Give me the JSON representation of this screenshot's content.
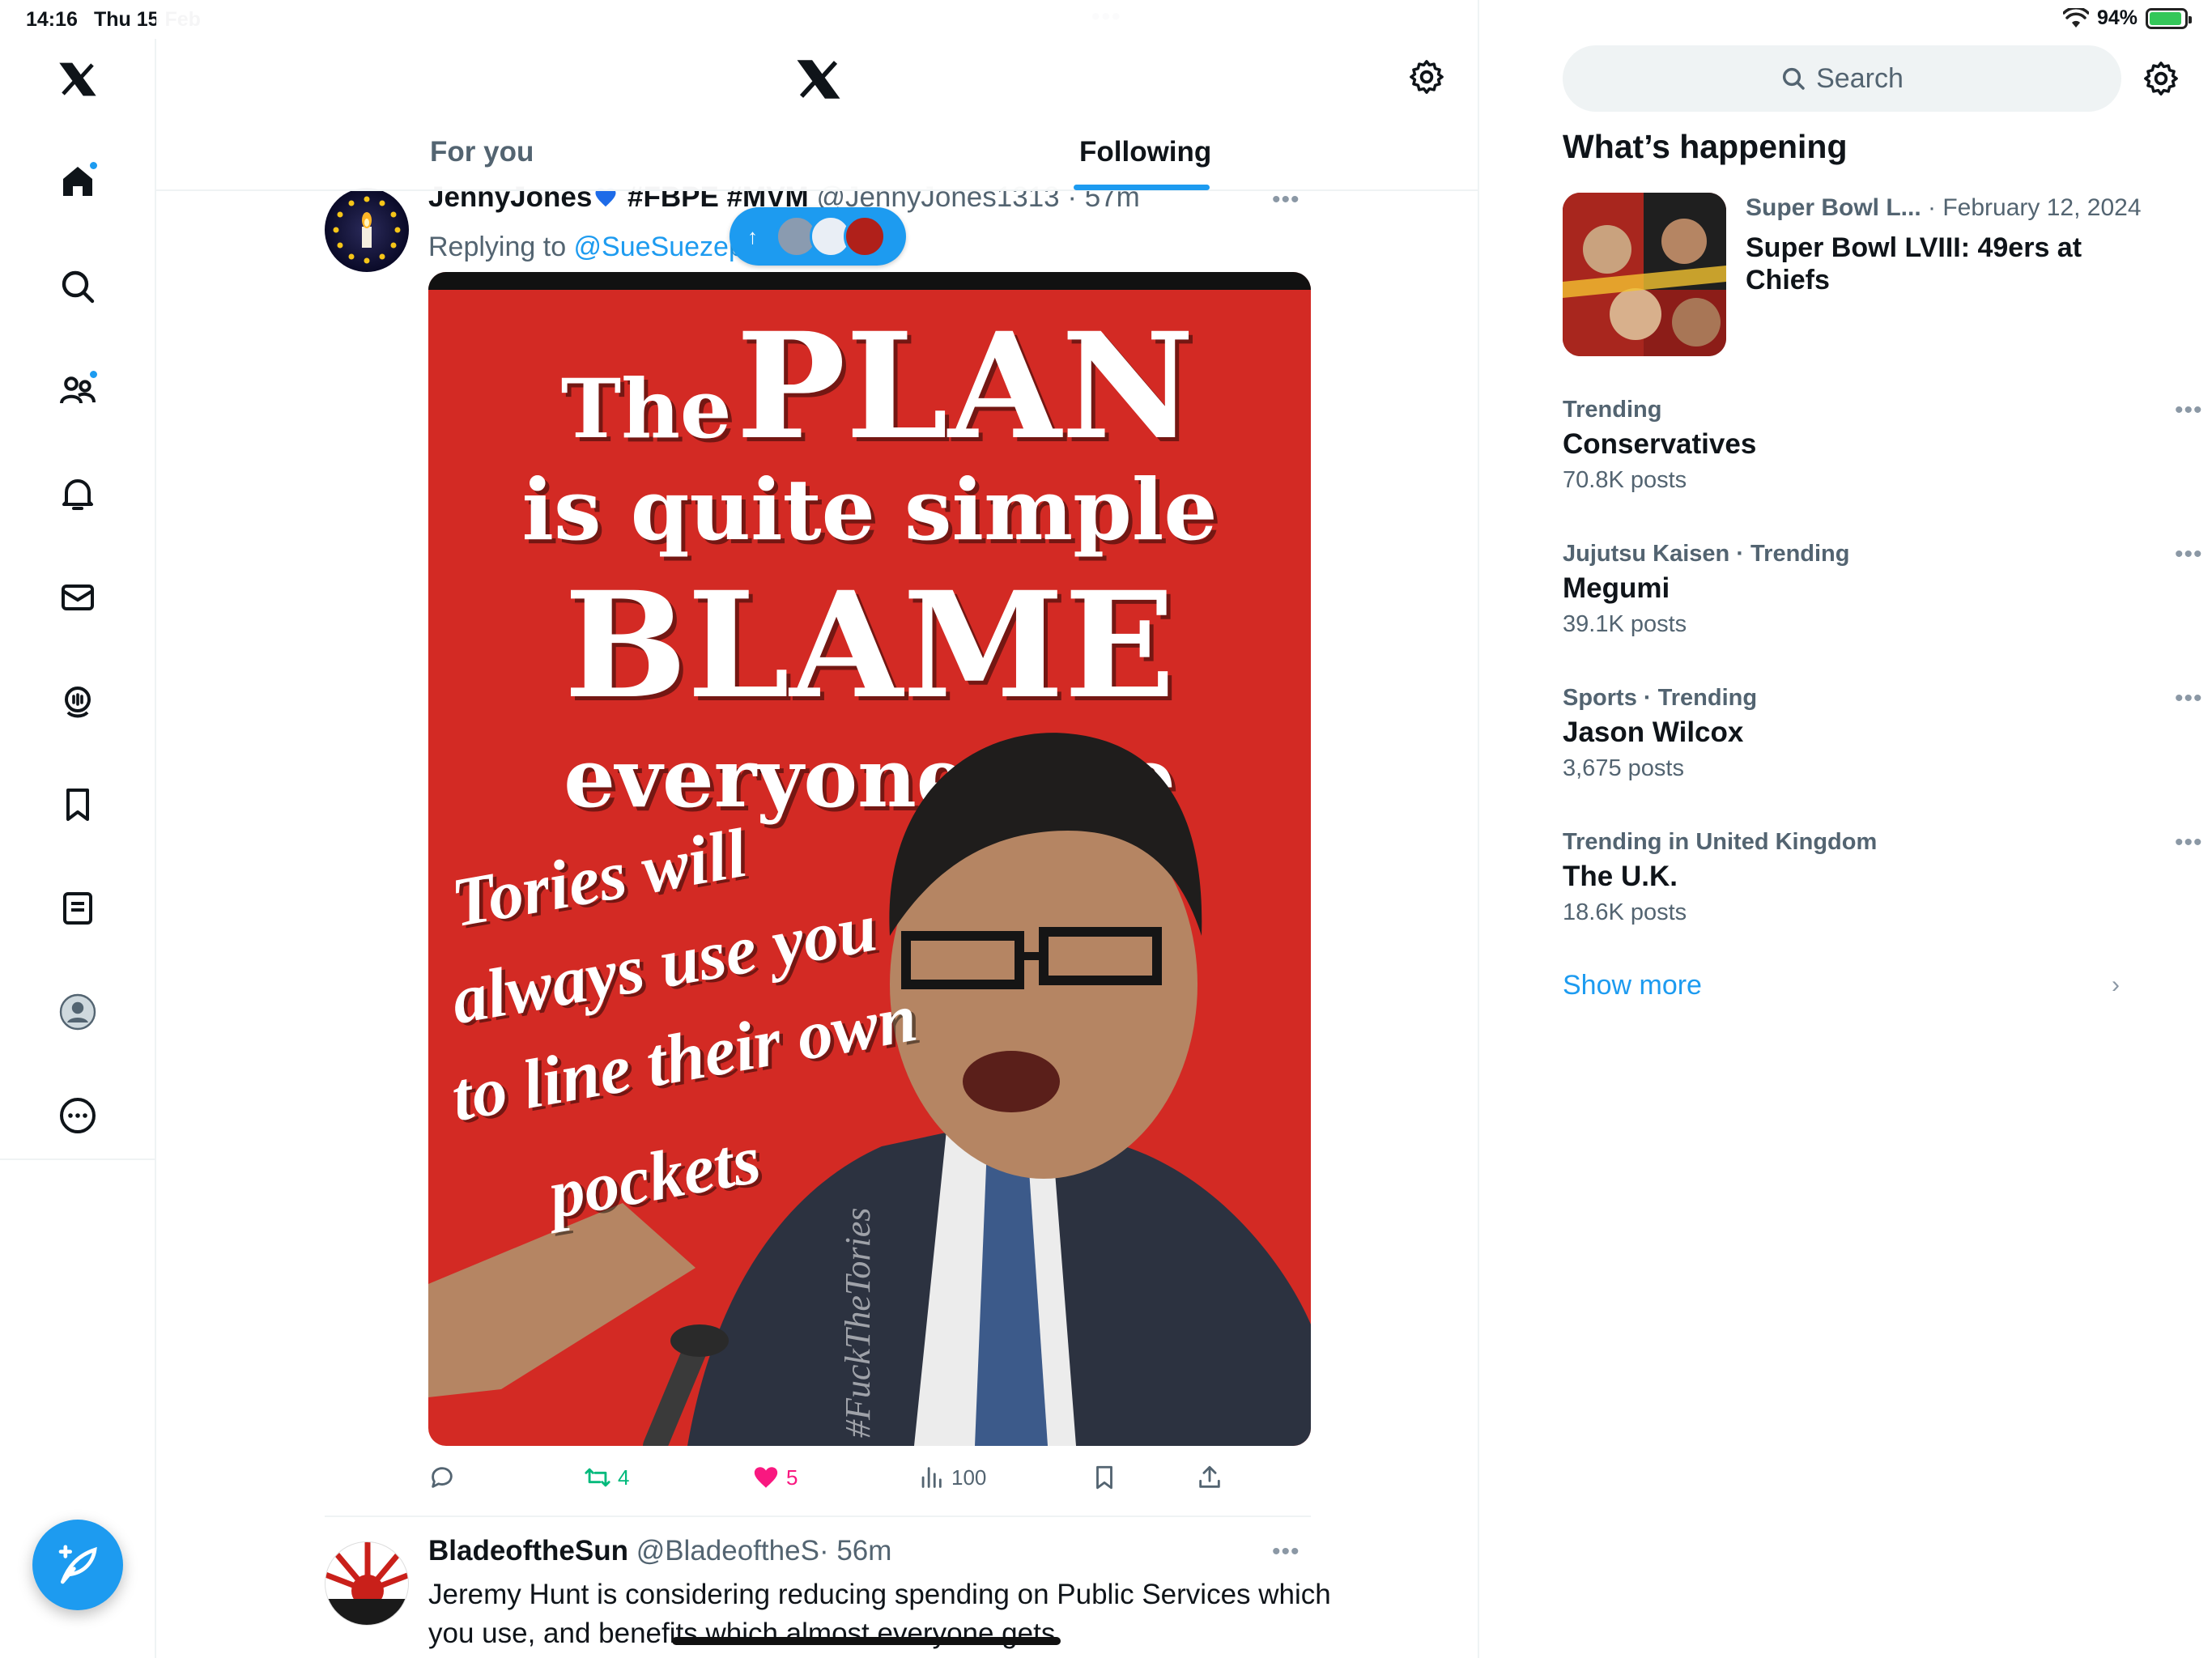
{
  "status_bar": {
    "time": "14:16",
    "date": "Thu 15 Feb",
    "battery": "94%",
    "battery_level": 0.94
  },
  "header": {
    "tabs": [
      {
        "label": "For you",
        "active": false
      },
      {
        "label": "Following",
        "active": true
      }
    ]
  },
  "tweets": [
    {
      "name": "JennyJones",
      "tags": "#FBPE #MVM",
      "handle": "@JennyJones1313",
      "time": "· 57m",
      "reply_prefix": "Replying to ",
      "reply_to": "@SueSuezep",
      "image": {
        "line1_small": "The",
        "line1_big": "PLAN",
        "line2": "is quite simple",
        "line3": "BLAME",
        "line4": "everyone else",
        "script": [
          "Tories will",
          "always use you",
          "to line their own",
          "pockets"
        ],
        "hashtag": "#FuckTheTories"
      },
      "stats": {
        "retweets": "4",
        "likes": "5",
        "views": "100"
      }
    },
    {
      "name": "BladeoftheSun",
      "handle": "@BladeoftheS",
      "time": "· 56m",
      "text": "Jeremy Hunt is considering reducing spending on Public Services which you use, and benefits which almost everyone gets"
    }
  ],
  "sidebar": {
    "search_placeholder": "Search",
    "whats_happening": "What’s happening",
    "featured": {
      "category": "Super Bowl L...",
      "date": "· February 12, 2024",
      "headline": "Super Bowl LVIII: 49ers at Chiefs"
    },
    "trends": [
      {
        "context": "Trending",
        "name": "Conservatives",
        "count": "70.8K posts"
      },
      {
        "context": "Jujutsu Kaisen · Trending",
        "name": "Megumi",
        "count": "39.1K posts"
      },
      {
        "context": "Sports · Trending",
        "name": "Jason Wilcox",
        "count": "3,675 posts"
      },
      {
        "context": "Trending in United Kingdom",
        "name": "The U.K.",
        "count": "18.6K posts"
      }
    ],
    "show_more": "Show more"
  },
  "colors": {
    "accent": "#1d9bf0",
    "like": "#f91880",
    "retweet": "#00ba7c",
    "meme_red": "#d32a24"
  }
}
